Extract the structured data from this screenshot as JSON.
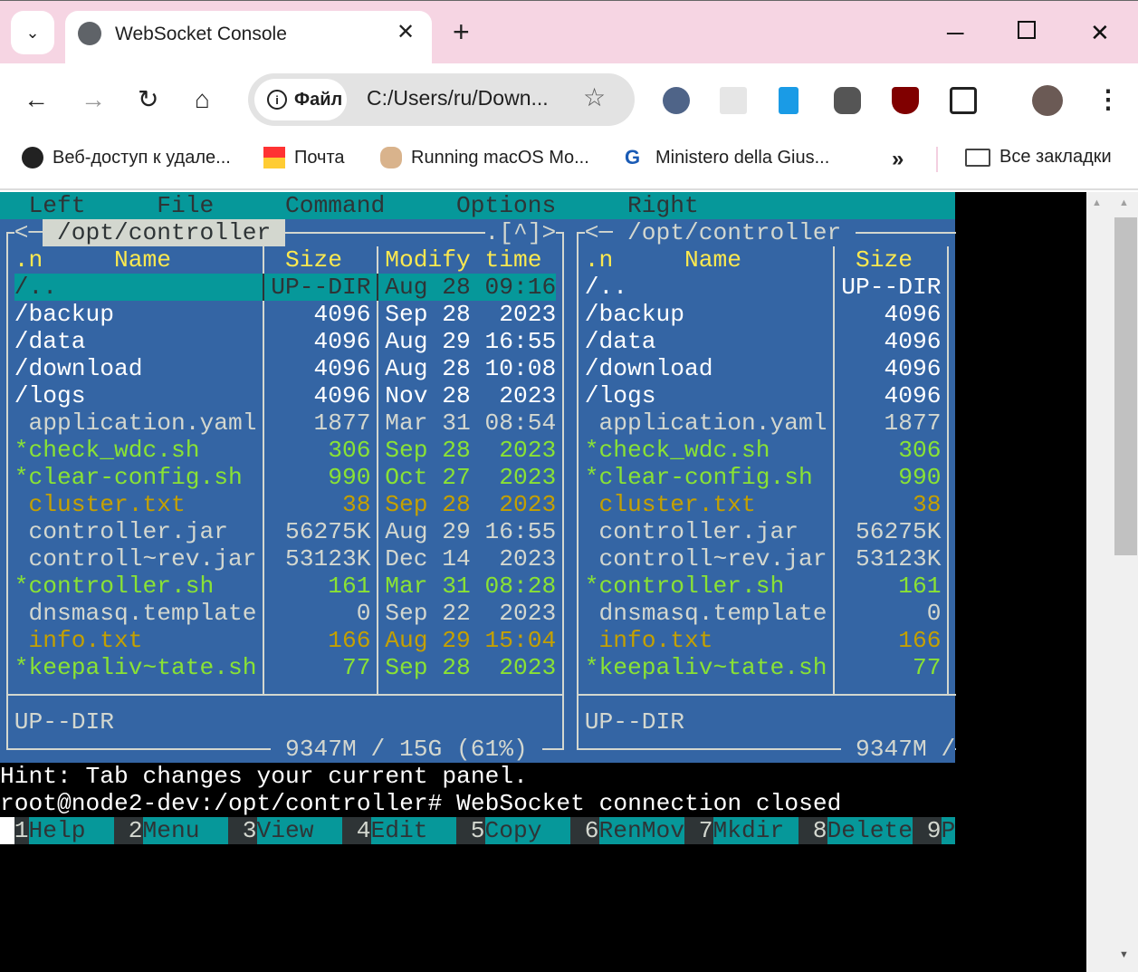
{
  "browser": {
    "tab_title": "WebSocket Console",
    "url_chip": "Файл",
    "url": "C:/Users/ru/Down...",
    "bookmarks": [
      {
        "label": "Веб-доступ к удале...",
        "icon": "globe-icon"
      },
      {
        "label": "Почта",
        "icon": "mail-icon"
      },
      {
        "label": "Running macOS Mo...",
        "icon": "site-icon"
      },
      {
        "label": "Ministero della Gius...",
        "icon": "google-icon"
      }
    ],
    "more": "»",
    "all_bookmarks": "Все закладки"
  },
  "colors": {
    "teal": "#06989a",
    "blue": "#3465a4",
    "fg": "#d3d7cf",
    "yellow": "#fce94f",
    "green": "#8ae234",
    "brown": "#c4a000",
    "dark": "#2e3436",
    "white": "#ffffff"
  },
  "terminal": {
    "menu": [
      {
        "label": "Left",
        "col": 2
      },
      {
        "label": "File",
        "col": 11
      },
      {
        "label": "Command",
        "col": 20
      },
      {
        "label": "Options",
        "col": 32
      },
      {
        "label": "Right",
        "col": 44
      }
    ],
    "left": {
      "path": " /opt/controller ",
      "arrow_left": "<─",
      "arrow_right": ".[^]>",
      "headers": {
        "n": ".n",
        "name": "Name",
        "size": "Size",
        "time": "Modify time"
      }
    },
    "right": {
      "path": " /opt/controller ",
      "arrow_left": "<─",
      "headers": {
        "n": ".n",
        "name": "Name",
        "size": "Size"
      }
    },
    "files": [
      {
        "name": "/..",
        "size": "UP--DIR",
        "time": "Aug 28 09:16",
        "kind": "dir",
        "selected": true
      },
      {
        "name": "/backup",
        "size": "4096",
        "time": "Sep 28  2023",
        "kind": "dir"
      },
      {
        "name": "/data",
        "size": "4096",
        "time": "Aug 29 16:55",
        "kind": "dir"
      },
      {
        "name": "/download",
        "size": "4096",
        "time": "Aug 28 10:08",
        "kind": "dir"
      },
      {
        "name": "/logs",
        "size": "4096",
        "time": "Nov 28  2023",
        "kind": "dir"
      },
      {
        "name": " application.yaml",
        "size": "1877",
        "time": "Mar 31 08:54",
        "kind": "file"
      },
      {
        "name": "*check_wdc.sh",
        "size": "306",
        "time": "Sep 28  2023",
        "kind": "exec"
      },
      {
        "name": "*clear-config.sh",
        "size": "990",
        "time": "Oct 27  2023",
        "kind": "exec"
      },
      {
        "name": " cluster.txt",
        "size": "38",
        "time": "Sep 28  2023",
        "kind": "text"
      },
      {
        "name": " controller.jar",
        "size": "56275K",
        "time": "Aug 29 16:55",
        "kind": "file"
      },
      {
        "name": " controll~rev.jar",
        "size": "53123K",
        "time": "Dec 14  2023",
        "kind": "file"
      },
      {
        "name": "*controller.sh",
        "size": "161",
        "time": "Mar 31 08:28",
        "kind": "exec"
      },
      {
        "name": " dnsmasq.template",
        "size": "0",
        "time": "Sep 22  2023",
        "kind": "file"
      },
      {
        "name": " info.txt",
        "size": "166",
        "time": "Aug 29 15:04",
        "kind": "text"
      },
      {
        "name": "*keepaliv~tate.sh",
        "size": "77",
        "time": "Sep 28  2023",
        "kind": "exec"
      }
    ],
    "left_status": "UP--DIR",
    "right_status": "UP--DIR",
    "left_disk": " 9347M / 15G (61%) ",
    "right_disk": " 9347M /",
    "hint": "Hint: Tab changes your current panel.",
    "prompt": "root@node2-dev:/opt/controller# WebSocket connection closed",
    "fkeys": [
      {
        "num": "1",
        "label": "Help"
      },
      {
        "num": "2",
        "label": "Menu"
      },
      {
        "num": "3",
        "label": "View"
      },
      {
        "num": "4",
        "label": "Edit"
      },
      {
        "num": "5",
        "label": "Copy"
      },
      {
        "num": "6",
        "label": "RenMov"
      },
      {
        "num": "7",
        "label": "Mkdir"
      },
      {
        "num": "8",
        "label": "Delete"
      },
      {
        "num": "9",
        "label": "P"
      }
    ]
  }
}
